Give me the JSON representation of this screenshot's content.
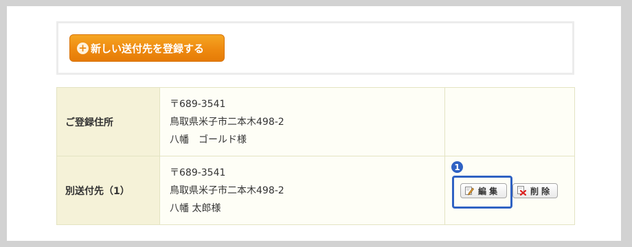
{
  "register": {
    "button_label": "新しい送付先を登録する",
    "icon": "plus-circle-icon"
  },
  "addresses": [
    {
      "label": "ご登録住所",
      "postal": "〒689-3541",
      "address": "鳥取県米子市二本木498-2",
      "name": "八幡　ゴールド様",
      "has_actions": false
    },
    {
      "label": "別送付先（1）",
      "postal": "〒689-3541",
      "address": "鳥取県米子市二本木498-2",
      "name": "八幡 太郎様",
      "has_actions": true
    }
  ],
  "actions": {
    "edit_label": "編 集",
    "delete_label": "削 除",
    "edit_icon": "pencil-icon",
    "delete_icon": "delete-x-icon"
  },
  "annotation": {
    "step_number": "1",
    "color": "#2f62c3"
  },
  "colors": {
    "accent": "#ee8a10",
    "label_bg": "#f5f2d8",
    "cell_bg": "#fefef6"
  }
}
